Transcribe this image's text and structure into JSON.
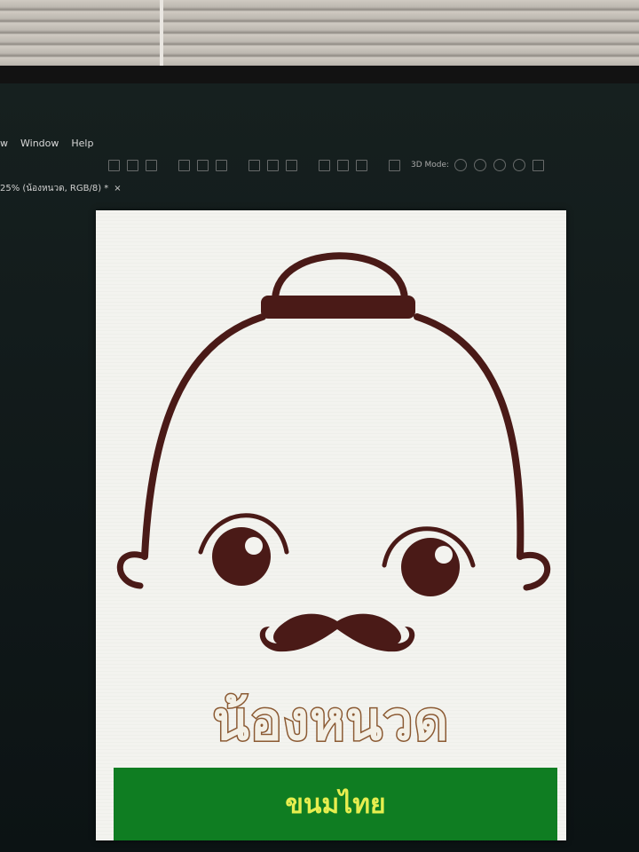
{
  "menu": {
    "items": [
      {
        "label": "w"
      },
      {
        "label": "Window"
      },
      {
        "label": "Help"
      }
    ]
  },
  "toolbar": {
    "mode_label": "3D Mode:"
  },
  "document_tab": {
    "title": "25% (น้องหนวด, RGB/8) *",
    "close_label": "×"
  },
  "artwork": {
    "title_text": "น้องหนวด",
    "band_text": "ขนมไทย",
    "colors": {
      "line": "#4a1a17",
      "band": "#0f7d22",
      "band_text": "#e6ee4f",
      "title_outline": "#8b5a33"
    }
  }
}
